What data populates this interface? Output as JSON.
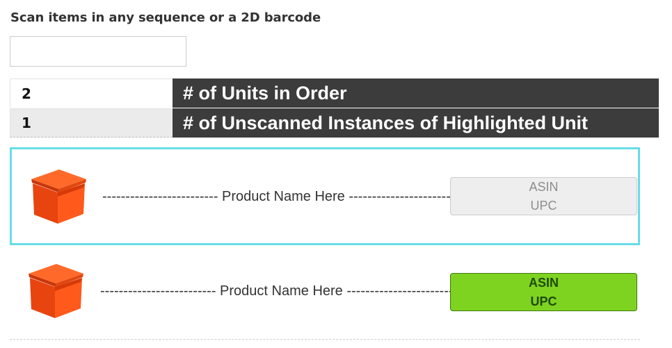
{
  "scan": {
    "heading": "Scan items in any sequence or a 2D barcode",
    "input_value": "",
    "input_placeholder": ""
  },
  "stats": [
    {
      "value": "2",
      "label": "# of Units in Order"
    },
    {
      "value": "1",
      "label": "# of Unscanned Instances of Highlighted Unit"
    }
  ],
  "items": [
    {
      "product_name": "------------------------- Product Name Here ------------------------",
      "asin_label": "ASIN",
      "upc_label": "UPC",
      "highlighted": true,
      "scanned": false,
      "icon": "box-icon"
    },
    {
      "product_name": "------------------------- Product Name Here ------------------------",
      "asin_label": "ASIN",
      "upc_label": "UPC",
      "highlighted": false,
      "scanned": true,
      "icon": "box-icon"
    }
  ],
  "colors": {
    "highlight_border": "#66dde8",
    "scanned_green": "#7ed321",
    "stat_label_bg": "#3c3c3c",
    "box_orange": "#f0531a"
  }
}
